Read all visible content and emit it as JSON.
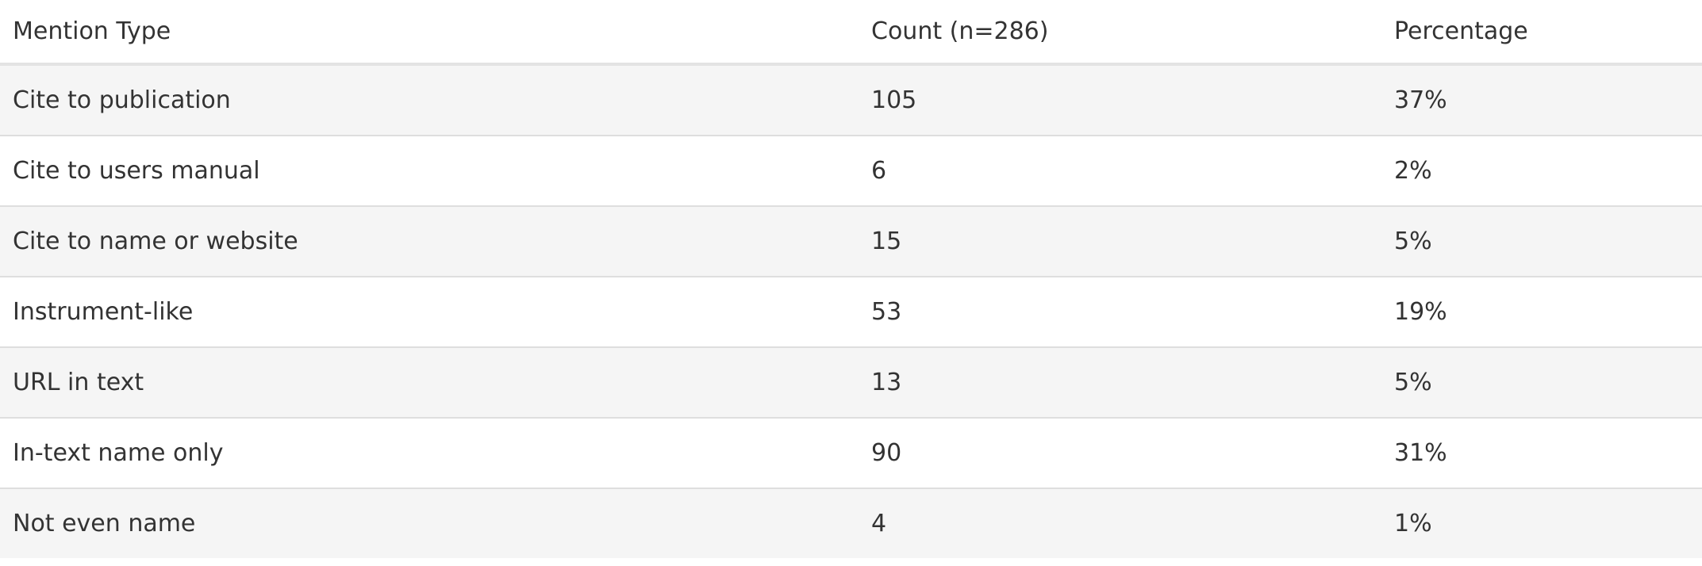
{
  "table": {
    "headers": [
      "Mention Type",
      "Count (n=286)",
      "Percentage"
    ],
    "rows": [
      [
        "Cite to publication",
        "105",
        "37%"
      ],
      [
        "Cite to users manual",
        "6",
        "2%"
      ],
      [
        "Cite to name or website",
        "15",
        "5%"
      ],
      [
        "Instrument-like",
        "53",
        "19%"
      ],
      [
        "URL in text",
        "13",
        "5%"
      ],
      [
        "In-text name only",
        "90",
        "31%"
      ],
      [
        "Not even name",
        "4",
        "1%"
      ]
    ]
  },
  "colors": {
    "text": "#333333",
    "row_stripe": "#f5f5f5",
    "row_plain": "#ffffff",
    "divider": "#dedede"
  }
}
